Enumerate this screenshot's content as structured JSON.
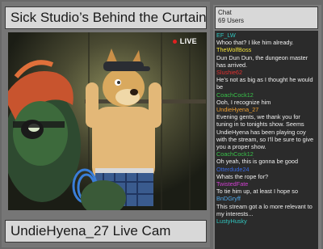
{
  "stream": {
    "title": "Sick Studio’s Behind the Curtains",
    "live_label": "LIVE",
    "cam_name": "UndieHyena_27 Live Cam"
  },
  "chat": {
    "title": "Chat",
    "users": "69 Users",
    "messages": [
      {
        "user": "EF_LW",
        "color": "#31c7c0",
        "text": "Whoo that?  I like him already."
      },
      {
        "user": "TheWolfBoss",
        "color": "#f2e23a",
        "text": "Dun Dun Dun, the dungeon master has arrived."
      },
      {
        "user": "Slushie62",
        "color": "#e03030",
        "text": "He’s not as big as I thought he would be"
      },
      {
        "user": "CoachCock12",
        "color": "#39c24a",
        "text": "Ooh, I recognize him"
      },
      {
        "user": "UndieHyena_27",
        "color": "#f0a030",
        "text": "Evening gents, we thank you for tuning in to tonights show.  Seems UndieHyena has been playing coy with the stream, so I’ll be sure to give you a proper show."
      },
      {
        "user": "CoachCock12",
        "color": "#39c24a",
        "text": "Oh yeah, this is gonna be good"
      },
      {
        "user": "Otterdude24",
        "color": "#3a6ae0",
        "text": "Whats the rope for?"
      },
      {
        "user": "TwistedFate",
        "color": "#d040d0",
        "text": "To tie him up, at least I hope so"
      },
      {
        "user": "BnDGryff",
        "color": "#50a8e8",
        "text": "This stream got a lo more relevant to my interests..."
      },
      {
        "user": "LustyHusky",
        "color": "#31c7c0",
        "text": ""
      }
    ]
  }
}
